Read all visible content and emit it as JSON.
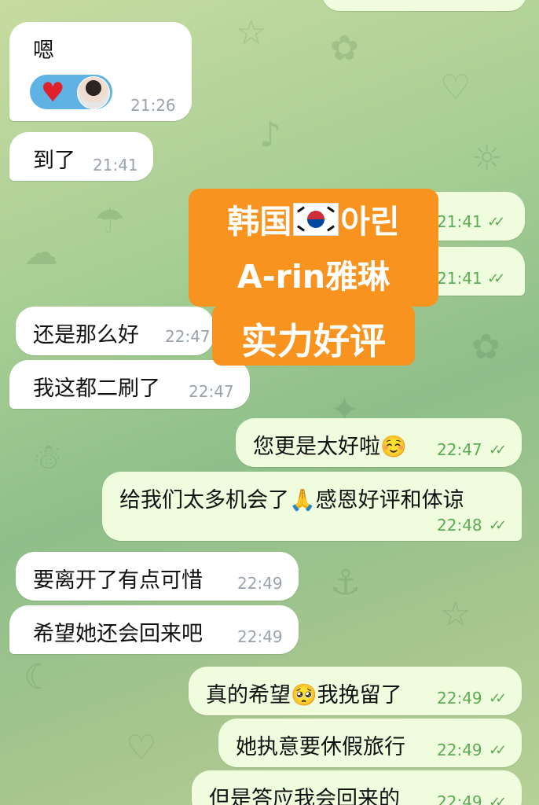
{
  "messages": [
    {
      "text": "嗯",
      "time": "21:26",
      "reaction": "heart-reaction"
    },
    {
      "text": "到了",
      "time": "21:41"
    },
    {
      "text": "",
      "time": "21:41"
    },
    {
      "text": "",
      "time": "21:41"
    },
    {
      "text": "还是那么好",
      "time": "22:47"
    },
    {
      "text": "我这都二刷了",
      "time": "22:47"
    },
    {
      "text": "您更是太好啦☺️",
      "time": "22:47"
    },
    {
      "text": "给我们太多机会了🙏感恩好评和体谅",
      "time": "22:48"
    },
    {
      "text": "要离开了有点可惜",
      "time": "22:49"
    },
    {
      "text": "希望她还会回来吧",
      "time": "22:49"
    },
    {
      "text": "真的希望🥺我挽留了",
      "time": "22:49"
    },
    {
      "text": "她执意要休假旅行",
      "time": "22:49"
    },
    {
      "text": "但是答应我会回来的",
      "time": "22:49"
    }
  ],
  "overlay": {
    "line1_a": "韩国",
    "line1_b": "아린",
    "line2": "A-rin雅琳",
    "line3": "实力好评"
  },
  "icons": {
    "read_receipt": "double-check-icon",
    "flag": "south-korea-flag-icon"
  },
  "colors": {
    "incoming_bubble": "#ffffff",
    "outgoing_bubble": "#effdde",
    "outgoing_time": "#5cab53",
    "incoming_time": "#9aa3ad",
    "overlay_bg": "#f7931e",
    "reaction_bg": "#5eb3e4"
  }
}
